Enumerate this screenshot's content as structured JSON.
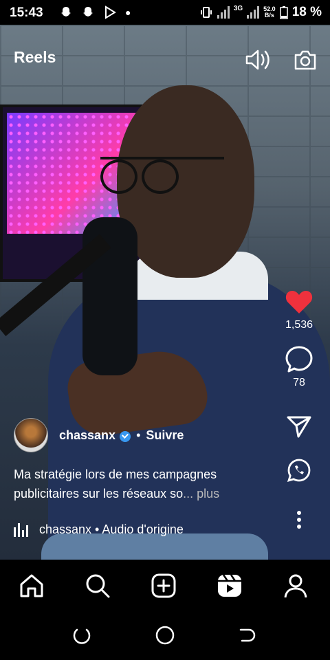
{
  "status_bar": {
    "time": "15:43",
    "network": "3G",
    "speed_value": "52.0",
    "speed_unit": "B/s",
    "battery": "18 %"
  },
  "header": {
    "title": "Reels"
  },
  "post": {
    "author": "chassanx",
    "follow_label": "Suivre",
    "separator": "•",
    "caption": "Ma stratégie lors de mes campagnes publicitaires sur les réseaux so",
    "caption_more": "... plus",
    "audio": "chassanx • Audio d'origine"
  },
  "actions": {
    "likes": "1,536",
    "comments": "78"
  },
  "colors": {
    "like": "#f0313d",
    "verified": "#3897f0"
  },
  "icons": {
    "top": [
      "speaker-icon",
      "camera-icon"
    ],
    "nav": [
      "home-icon",
      "search-icon",
      "add-icon",
      "reels-icon",
      "profile-icon"
    ],
    "actions": [
      "heart-icon",
      "comment-icon",
      "send-icon",
      "whatsapp-icon",
      "more-icon"
    ]
  }
}
